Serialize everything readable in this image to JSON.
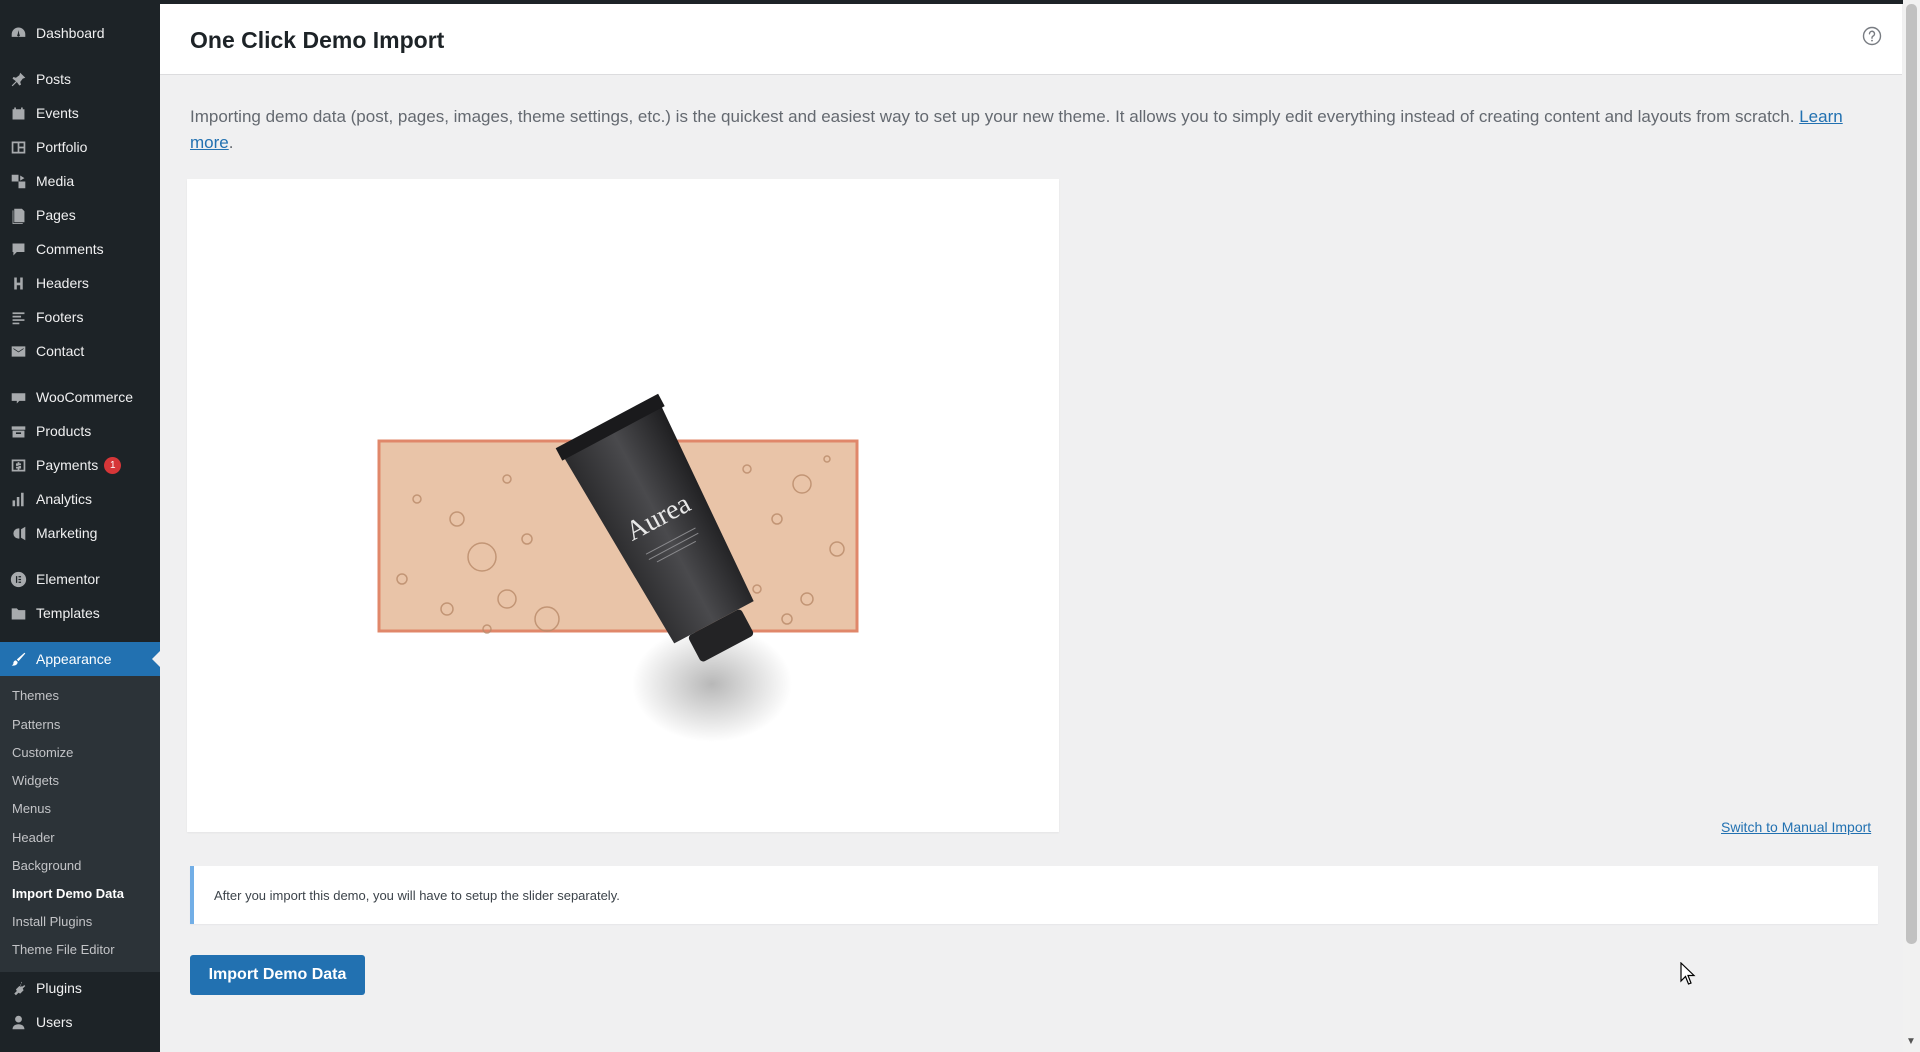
{
  "sidebar": {
    "items": [
      {
        "label": "Dashboard",
        "icon": "dashboard-icon"
      },
      {
        "label": "Posts",
        "icon": "pin-icon"
      },
      {
        "label": "Events",
        "icon": "events-icon"
      },
      {
        "label": "Portfolio",
        "icon": "portfolio-icon"
      },
      {
        "label": "Media",
        "icon": "media-icon"
      },
      {
        "label": "Pages",
        "icon": "pages-icon"
      },
      {
        "label": "Comments",
        "icon": "comment-icon"
      },
      {
        "label": "Headers",
        "icon": "headers-icon"
      },
      {
        "label": "Footers",
        "icon": "footers-icon"
      },
      {
        "label": "Contact",
        "icon": "mail-icon"
      },
      {
        "label": "WooCommerce",
        "icon": "woo-icon"
      },
      {
        "label": "Products",
        "icon": "products-icon"
      },
      {
        "label": "Payments",
        "icon": "payments-icon",
        "badge": "1"
      },
      {
        "label": "Analytics",
        "icon": "analytics-icon"
      },
      {
        "label": "Marketing",
        "icon": "megaphone-icon"
      },
      {
        "label": "Elementor",
        "icon": "elementor-icon"
      },
      {
        "label": "Templates",
        "icon": "folder-icon"
      },
      {
        "label": "Appearance",
        "icon": "brush-icon"
      },
      {
        "label": "Plugins",
        "icon": "plugin-icon"
      },
      {
        "label": "Users",
        "icon": "user-icon"
      }
    ],
    "submenu": [
      "Themes",
      "Patterns",
      "Customize",
      "Widgets",
      "Menus",
      "Header",
      "Background",
      "Import Demo Data",
      "Install Plugins",
      "Theme File Editor"
    ]
  },
  "page": {
    "title": "One Click Demo Import",
    "intro": "Importing demo data (post, pages, images, theme settings, etc.) is the quickest and easiest way to set up your new theme. It allows you to simply edit everything instead of creating content and layouts from scratch.",
    "learn_more": "Learn more",
    "product_brand": "Aurea",
    "switch_label": "Switch to Manual Import",
    "notice": "After you import this demo, you will have to setup the slider separately.",
    "import_button": "Import Demo Data"
  },
  "colors": {
    "accent": "#2271b1",
    "sidebar": "#1d2327",
    "badge": "#d63638",
    "notice_border": "#72aee6"
  }
}
